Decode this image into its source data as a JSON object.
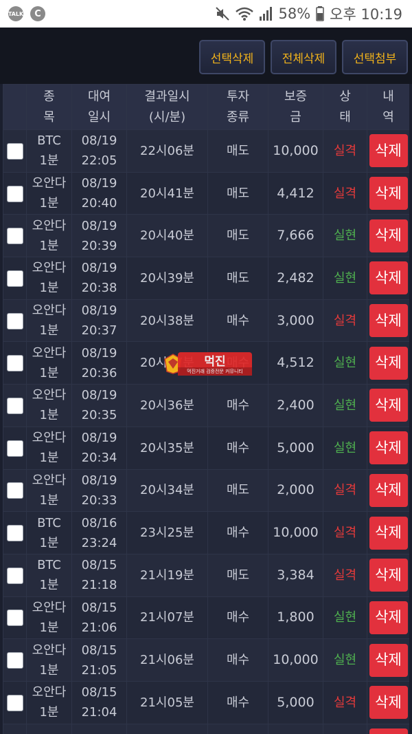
{
  "status_bar": {
    "talk_label": "TALK",
    "c_label": "C",
    "battery": "58%",
    "time": "오후 10:19"
  },
  "toolbar": {
    "select_delete": "선택삭제",
    "delete_all": "전체삭제",
    "select_attach": "선택첨부"
  },
  "table": {
    "headers": {
      "item": [
        "종",
        "목"
      ],
      "borrow_time": [
        "대여",
        "일시"
      ],
      "result_time": [
        "결과일시",
        "(시/분)"
      ],
      "invest_type": [
        "투자",
        "종류"
      ],
      "deposit": [
        "보증",
        "금"
      ],
      "state": [
        "상",
        "태"
      ],
      "history": [
        "내",
        "역"
      ]
    },
    "delete_label": "삭제",
    "rows": [
      {
        "item": [
          "BTC",
          "1분"
        ],
        "date": [
          "08/19",
          "22:05"
        ],
        "result": "22시06분",
        "type": "매도",
        "amount": "10,000",
        "state": "실격",
        "ok": false
      },
      {
        "item": [
          "오안다",
          "1분"
        ],
        "date": [
          "08/19",
          "20:40"
        ],
        "result": "20시41분",
        "type": "매도",
        "amount": "4,412",
        "state": "실격",
        "ok": false
      },
      {
        "item": [
          "오안다",
          "1분"
        ],
        "date": [
          "08/19",
          "20:39"
        ],
        "result": "20시40분",
        "type": "매도",
        "amount": "7,666",
        "state": "실현",
        "ok": true
      },
      {
        "item": [
          "오안다",
          "1분"
        ],
        "date": [
          "08/19",
          "20:38"
        ],
        "result": "20시39분",
        "type": "매도",
        "amount": "2,482",
        "state": "실현",
        "ok": true
      },
      {
        "item": [
          "오안다",
          "1분"
        ],
        "date": [
          "08/19",
          "20:37"
        ],
        "result": "20시38분",
        "type": "매수",
        "amount": "3,000",
        "state": "실격",
        "ok": false
      },
      {
        "item": [
          "오안다",
          "1분"
        ],
        "date": [
          "08/19",
          "20:36"
        ],
        "result": "20시37분",
        "type": "매수",
        "amount": "4,512",
        "state": "실현",
        "ok": true
      },
      {
        "item": [
          "오안다",
          "1분"
        ],
        "date": [
          "08/19",
          "20:35"
        ],
        "result": "20시36분",
        "type": "매수",
        "amount": "2,400",
        "state": "실현",
        "ok": true
      },
      {
        "item": [
          "오안다",
          "1분"
        ],
        "date": [
          "08/19",
          "20:34"
        ],
        "result": "20시35분",
        "type": "매수",
        "amount": "5,000",
        "state": "실현",
        "ok": true
      },
      {
        "item": [
          "오안다",
          "1분"
        ],
        "date": [
          "08/19",
          "20:33"
        ],
        "result": "20시34분",
        "type": "매도",
        "amount": "2,000",
        "state": "실격",
        "ok": false
      },
      {
        "item": [
          "BTC",
          "1분"
        ],
        "date": [
          "08/16",
          "23:24"
        ],
        "result": "23시25분",
        "type": "매수",
        "amount": "10,000",
        "state": "실격",
        "ok": false
      },
      {
        "item": [
          "BTC",
          "1분"
        ],
        "date": [
          "08/15",
          "21:18"
        ],
        "result": "21시19분",
        "type": "매도",
        "amount": "3,384",
        "state": "실격",
        "ok": false
      },
      {
        "item": [
          "오안다",
          "1분"
        ],
        "date": [
          "08/15",
          "21:06"
        ],
        "result": "21시07분",
        "type": "매수",
        "amount": "1,800",
        "state": "실현",
        "ok": true
      },
      {
        "item": [
          "오안다",
          "1분"
        ],
        "date": [
          "08/15",
          "21:05"
        ],
        "result": "21시06분",
        "type": "매수",
        "amount": "10,000",
        "state": "실현",
        "ok": true
      },
      {
        "item": [
          "오안다",
          "1분"
        ],
        "date": [
          "08/15",
          "21:04"
        ],
        "result": "21시05분",
        "type": "매수",
        "amount": "5,000",
        "state": "실격",
        "ok": false
      },
      {
        "item": [
          "BTC",
          ""
        ],
        "date": [
          "08/15",
          ""
        ],
        "result": "",
        "type": "",
        "amount": "",
        "state": "",
        "ok": false
      }
    ]
  },
  "watermark": {
    "title": "먹진",
    "subtitle": "먹진거래 검증전문 커뮤니티"
  },
  "colors": {
    "accent": "#f2b31b",
    "delete": "#e2313d",
    "fail": "#e53a3a",
    "success": "#4fb04f"
  }
}
